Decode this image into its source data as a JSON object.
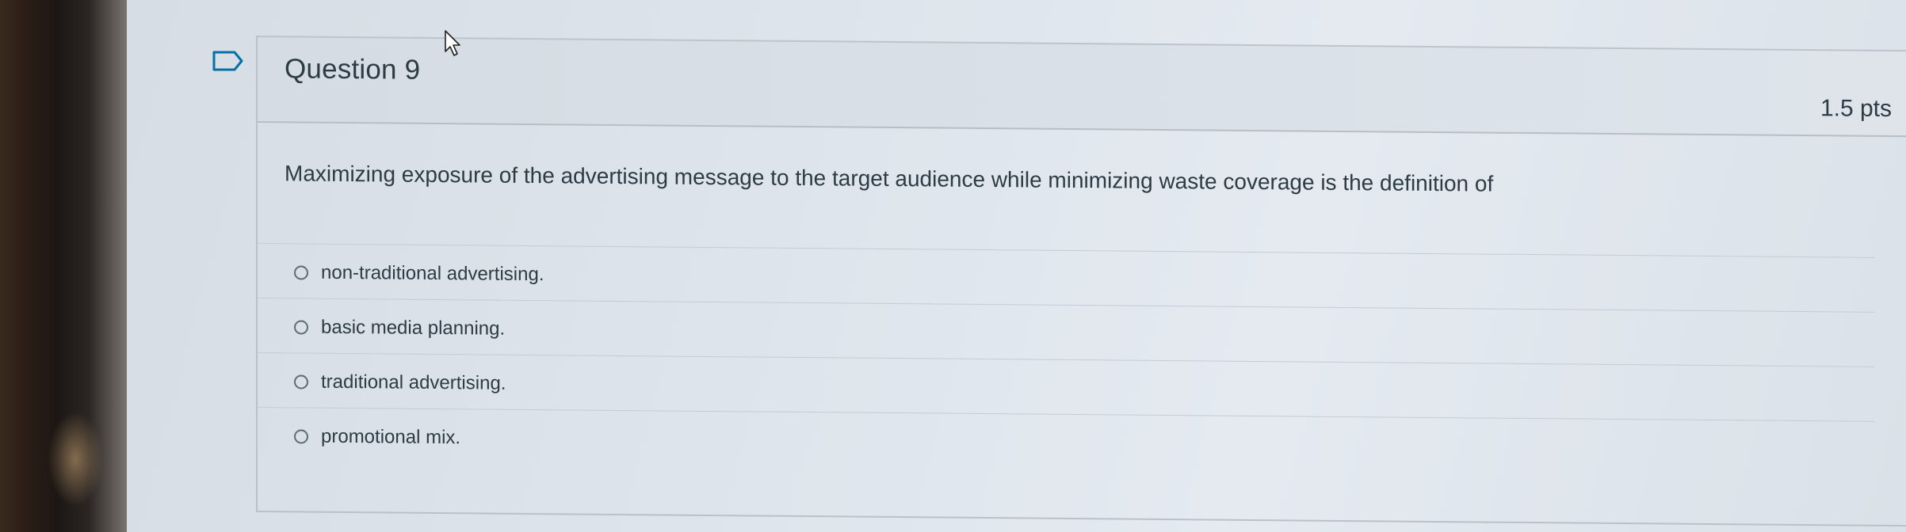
{
  "question": {
    "title": "Question 9",
    "points": "1.5 pts",
    "text": "Maximizing exposure of the advertising message to the target audience while minimizing waste coverage is the definition of",
    "answers": [
      {
        "label": "non-traditional advertising."
      },
      {
        "label": "basic media planning."
      },
      {
        "label": "traditional advertising."
      },
      {
        "label": "promotional mix."
      }
    ]
  },
  "icons": {
    "flag": "bookmark-flag-icon",
    "cursor": "mouse-pointer-icon"
  },
  "colors": {
    "text": "#2d3b45",
    "flag": "#0770a3",
    "header_bg": "#d8dfe6"
  }
}
